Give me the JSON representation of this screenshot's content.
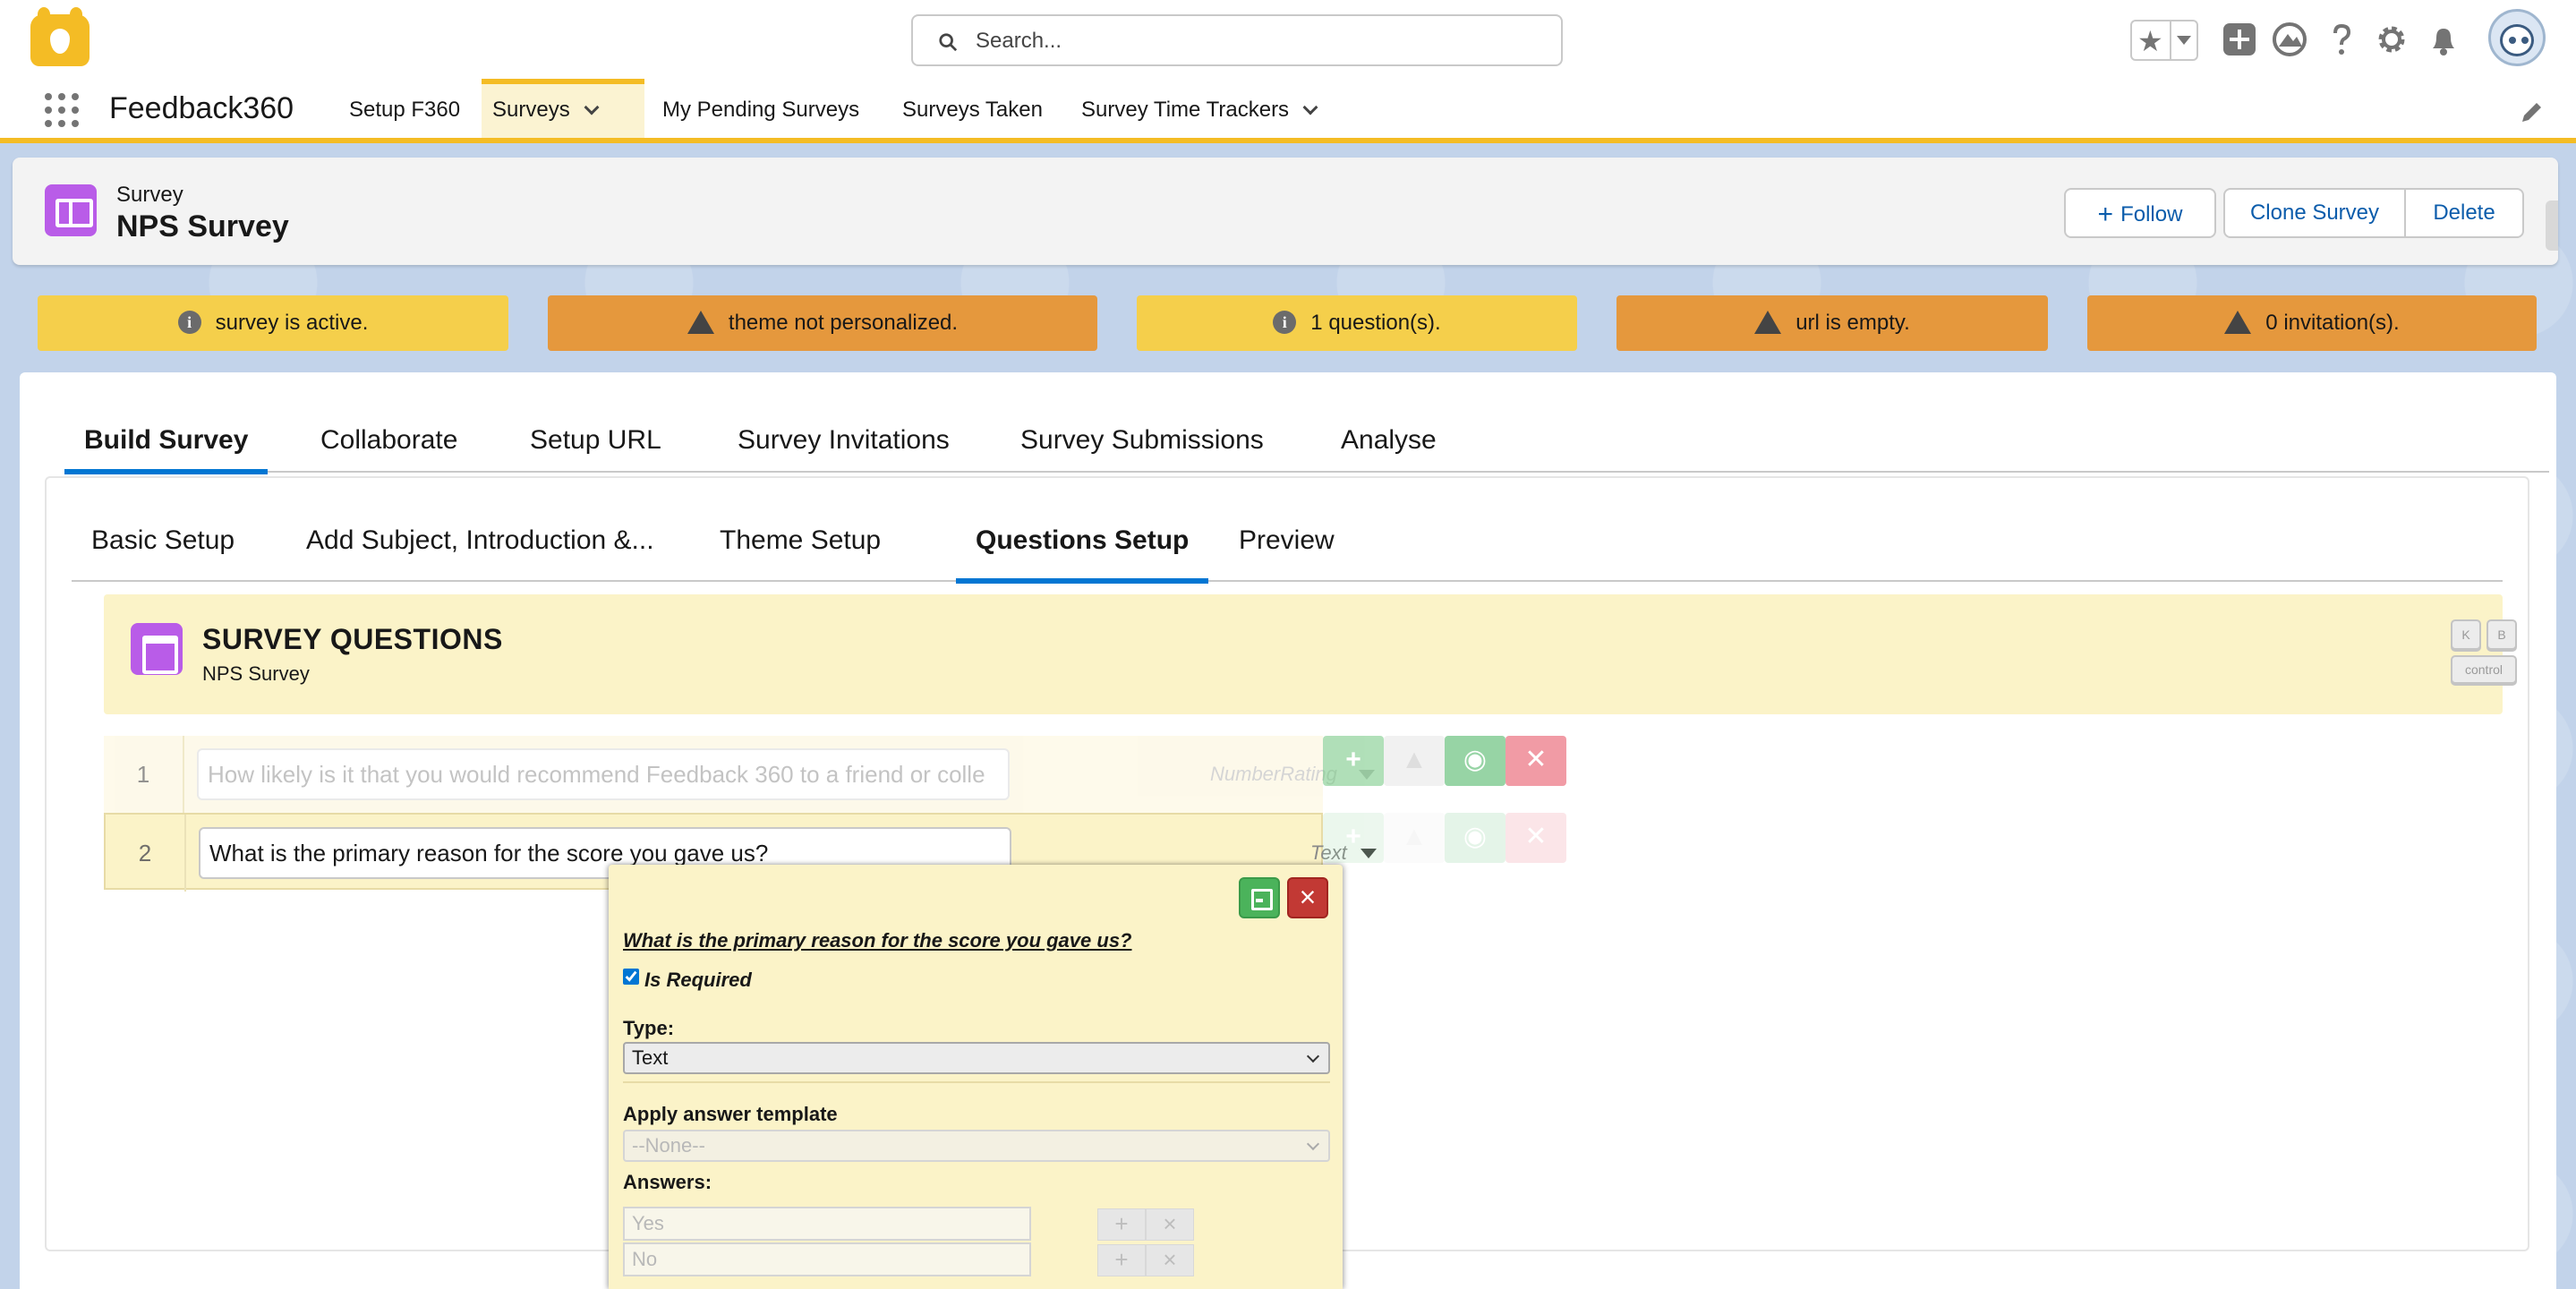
{
  "global_header": {
    "search_placeholder": "Search...",
    "icons": [
      "favorites-star-icon",
      "add-icon",
      "trailhead-icon",
      "help-icon",
      "setup-gear-icon",
      "notifications-bell-icon",
      "user-avatar"
    ]
  },
  "app_nav": {
    "app_name": "Feedback360",
    "items": [
      {
        "label": "Setup F360",
        "active": false,
        "has_menu": false
      },
      {
        "label": "Surveys",
        "active": true,
        "has_menu": true
      },
      {
        "label": "My Pending Surveys",
        "active": false,
        "has_menu": false
      },
      {
        "label": "Surveys Taken",
        "active": false,
        "has_menu": false
      },
      {
        "label": "Survey Time Trackers",
        "active": false,
        "has_menu": true
      }
    ]
  },
  "record": {
    "object_type": "Survey",
    "name": "NPS Survey",
    "actions": {
      "follow": "Follow",
      "clone": "Clone Survey",
      "delete": "Delete"
    }
  },
  "banners": [
    {
      "text": "survey is active.",
      "kind": "info",
      "color": "#f5cf4b"
    },
    {
      "text": "theme not personalized.",
      "kind": "warning",
      "color": "#e5983d"
    },
    {
      "text": "1 question(s).",
      "kind": "info",
      "color": "#f5cf4b"
    },
    {
      "text": "url is empty.",
      "kind": "warning",
      "color": "#e5983d"
    },
    {
      "text": "0 invitation(s).",
      "kind": "warning",
      "color": "#e5983d"
    }
  ],
  "main_tabs": [
    {
      "label": "Build Survey",
      "active": true
    },
    {
      "label": "Collaborate",
      "active": false
    },
    {
      "label": "Setup URL",
      "active": false
    },
    {
      "label": "Survey Invitations",
      "active": false
    },
    {
      "label": "Survey Submissions",
      "active": false
    },
    {
      "label": "Analyse",
      "active": false
    }
  ],
  "sub_tabs": [
    {
      "label": "Basic Setup",
      "active": false
    },
    {
      "label": "Add Subject, Introduction &...",
      "active": false
    },
    {
      "label": "Theme Setup",
      "active": false
    },
    {
      "label": "Questions Setup",
      "active": true
    },
    {
      "label": "Preview",
      "active": false
    }
  ],
  "survey_questions": {
    "title": "SURVEY QUESTIONS",
    "subtitle": "NPS Survey",
    "shortcut_keys": {
      "k": "K",
      "b": "B",
      "control": "control"
    }
  },
  "questions": [
    {
      "number": "1",
      "text": "How likely is it that you would recommend Feedback 360 to a friend or colle",
      "type": "NumberRating"
    },
    {
      "number": "2",
      "text": "What is the primary reason for the score you gave us?",
      "type": "Text"
    }
  ],
  "editor": {
    "question": "What is the primary reason for the score you gave us?",
    "is_required_label": "Is Required",
    "is_required": true,
    "type_label": "Type:",
    "type_value": "Text",
    "template_label": "Apply answer template",
    "template_value": "--None--",
    "answers_label": "Answers:",
    "answers": [
      "Yes",
      "No"
    ]
  },
  "colors": {
    "brand_yellow": "#f4bc25",
    "accent_blue": "#0176d3",
    "link_blue": "#0b5cab",
    "icon_purple": "#b95ce8",
    "panel_yellow": "#fbf3c8"
  }
}
